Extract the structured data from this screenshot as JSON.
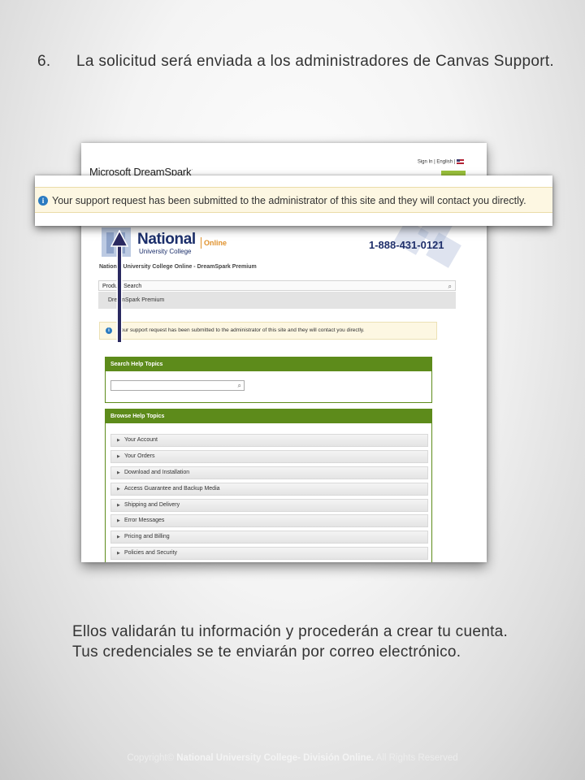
{
  "step": {
    "number": "6.",
    "text": "La solicitud será enviada a los administradores de Canvas Support."
  },
  "screenshot": {
    "brand": "Microsoft DreamSpark",
    "top_links": {
      "sign_in": "Sign In",
      "separator": "|",
      "language": "English",
      "separator2": "|"
    },
    "logo": {
      "national": "National",
      "college": "University College",
      "online": "Online"
    },
    "phone": "1-888-431-0121",
    "site_title": "National University College Online - DreamSpark Premium",
    "product_search": {
      "label": "Product Search",
      "icon": "search-icon"
    },
    "product_item": "DreamSpark Premium",
    "notice": "Your support request has been submitted to the administrator of this site and they will contact you directly.",
    "search_help": {
      "title": "Search Help Topics",
      "value": "",
      "icon": "search-icon"
    },
    "browse_help": {
      "title": "Browse Help Topics",
      "topics": [
        "Your Account",
        "Your Orders",
        "Download and Installation",
        "Access Guarantee and Backup Media",
        "Shipping and Delivery",
        "Error Messages",
        "Pricing and Billing",
        "Policies and Security"
      ]
    }
  },
  "callout": {
    "icon": "info-icon",
    "message": "Your support request has been submitted to the administrator of this site and they will contact you directly."
  },
  "outro": {
    "line1": "Ellos validarán tu información y procederán a crear tu cuenta.",
    "line2": "Tus credenciales se te enviarán por correo electrónico."
  },
  "footer": {
    "prefix": "Copyright© ",
    "org": "National University College- División Online.",
    "suffix": " All Rights Reserved"
  },
  "colors": {
    "header_green": "#5d8b1b",
    "notice_bg": "#fdf7e2",
    "brand_blue": "#1c2f6b",
    "arrow": "#2a2960"
  }
}
